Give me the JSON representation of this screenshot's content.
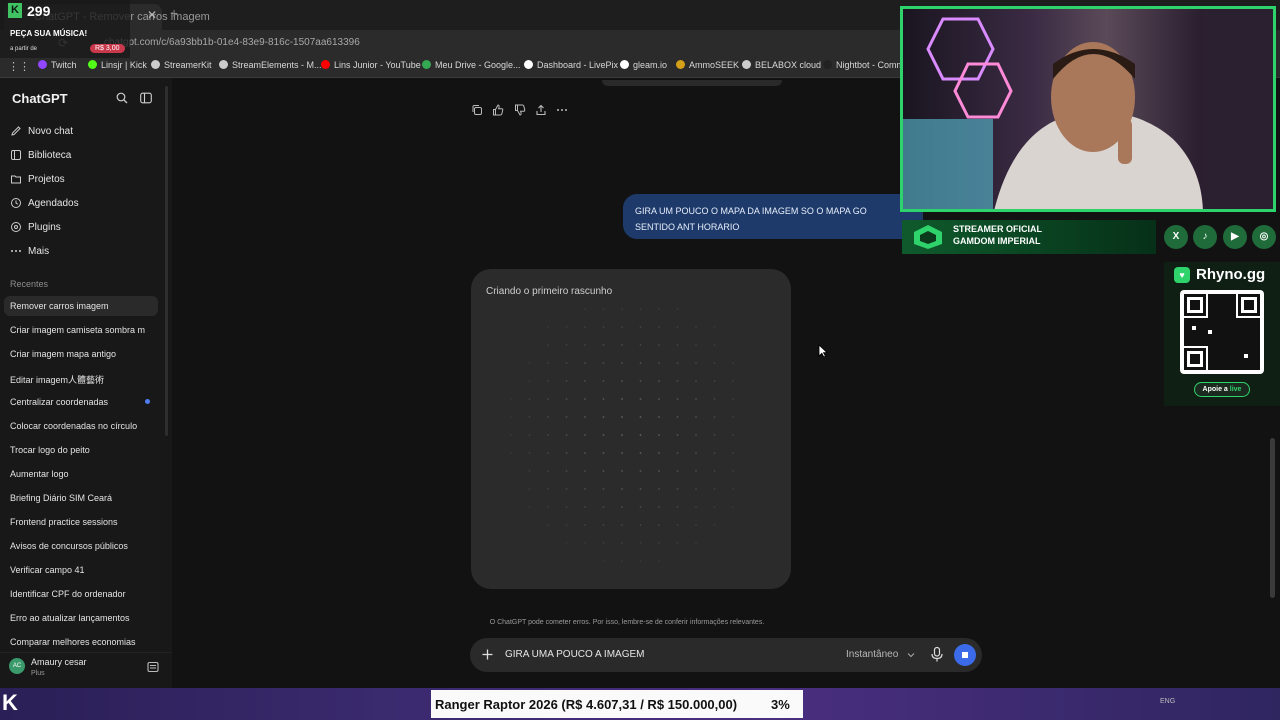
{
  "browser": {
    "tab_title": "ChatGPT - Remover carros imagem",
    "new_tab": "+",
    "url": "chatgpt.com/c/6a93bb1b-01e4-83e9-816c-1507aa613396",
    "bookmarks": [
      {
        "label": "Twitch",
        "color": "#9146ff"
      },
      {
        "label": "Linsjr | Kick",
        "color": "#53fc18"
      },
      {
        "label": "StreamerKit",
        "color": "#cccccc"
      },
      {
        "label": "StreamElements - M...",
        "color": "#cccccc"
      },
      {
        "label": "Lins Junior - YouTube",
        "color": "#ff0000"
      },
      {
        "label": "Meu Drive - Google...",
        "color": "#34a853"
      },
      {
        "label": "Dashboard - LivePix",
        "color": "#ffffff"
      },
      {
        "label": "gleam.io",
        "color": "#ffffff"
      },
      {
        "label": "AmmoSEEK",
        "color": "#d4a017"
      },
      {
        "label": "BELABOX cloud",
        "color": "#cccccc"
      },
      {
        "label": "Nightbot - Comm",
        "color": "#222222"
      }
    ]
  },
  "sidebar": {
    "logo": "ChatGPT",
    "nav": [
      {
        "label": "Novo chat",
        "icon": "edit-icon"
      },
      {
        "label": "Biblioteca",
        "icon": "library-icon"
      },
      {
        "label": "Projetos",
        "icon": "folder-icon"
      },
      {
        "label": "Agendados",
        "icon": "clock-icon"
      },
      {
        "label": "Plugins",
        "icon": "plugin-icon"
      },
      {
        "label": "Mais",
        "icon": "more-icon"
      }
    ],
    "recentes_title": "Recentes",
    "chats": [
      "Remover carros imagem",
      "Criar imagem camiseta sombra m",
      "Criar imagem mapa antigo",
      "Editar imagem人體藝術",
      "Centralizar coordenadas",
      "Colocar coordenadas no círculo",
      "Trocar logo do peito",
      "Aumentar logo",
      "Briefing Diário SIM Ceará",
      "Frontend practice sessions",
      "Avisos de concursos públicos",
      "Verificar campo 41",
      "Identificar CPF do ordenador",
      "Erro ao atualizar lançamentos",
      "Comparar melhores economias"
    ],
    "user": {
      "initials": "AC",
      "name": "Amaury cesar",
      "plan": "Plus"
    }
  },
  "main": {
    "user_message": "GIRA UM POUCO O MAPA DA IMAGEM SO O MAPA GO\nSENTIDO ANT HORARIO",
    "draft_title": "Criando o primeiro rascunho",
    "disclaimer": "O ChatGPT pode cometer erros. Por isso, lembre-se de conferir informações relevantes.",
    "composer": {
      "text": "GIRA UMA POUCO A IMAGEM",
      "model": "Instantâneo"
    }
  },
  "overlays": {
    "counter": {
      "badge": "K",
      "value": "299"
    },
    "song_request": {
      "title": "PEÇA SUA MÚSICA!",
      "subtitle": "a partir de",
      "price": "R$ 3,00"
    },
    "banner": {
      "line1": "STREAMER OFICIAL",
      "line2": "GAMDOM IMPERIAL"
    },
    "qr": {
      "title": "Rhyno.gg",
      "cta_prefix": "Apoie a ",
      "cta_highlight": "live"
    },
    "goal": {
      "text": "Ranger Raptor 2026 (R$ 4.607,31 / R$ 150.000,00)",
      "percent": "3%"
    },
    "taskbar": "ENG"
  },
  "colors": {
    "accent": "#3b6be8",
    "user_bubble": "#1d3a6a",
    "overlay_green": "#2fd36b"
  }
}
